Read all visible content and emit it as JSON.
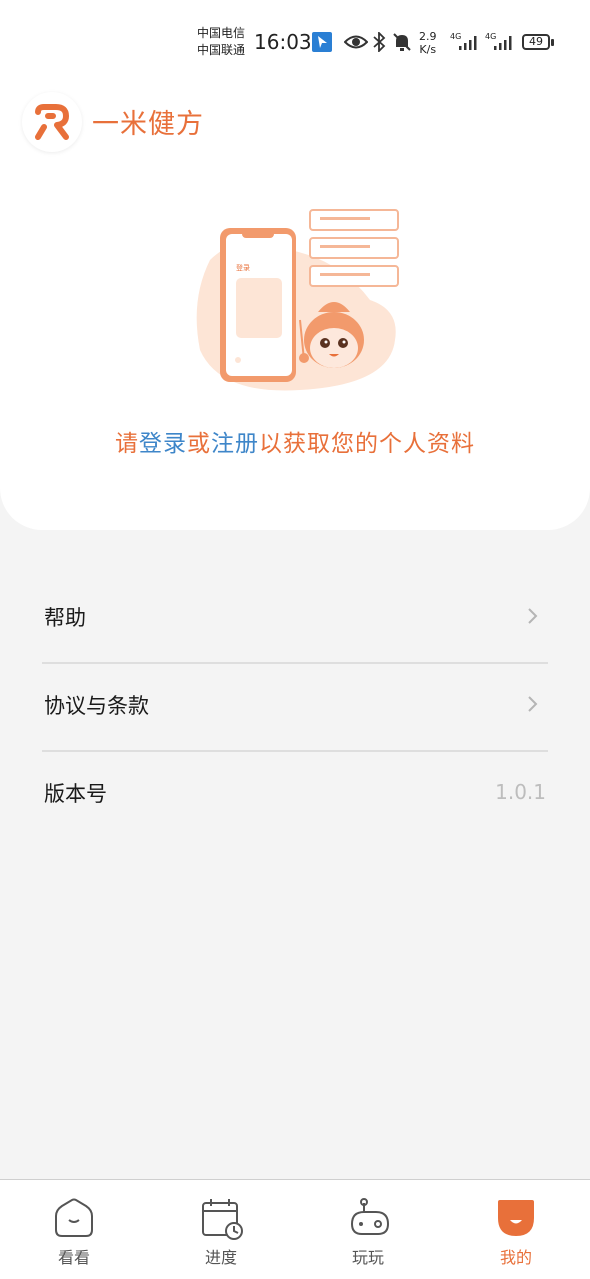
{
  "status_bar": {
    "carrier_1": "中国电信",
    "carrier_2": "中国联通",
    "time": "16:03",
    "speed_value": "2.9",
    "speed_unit": "K/s",
    "network_1": "4G",
    "network_2": "4G",
    "battery": "49",
    "icons": [
      "location-arrow-icon",
      "eye-icon",
      "bluetooth-icon",
      "mute-bell-icon",
      "signal-icon"
    ]
  },
  "header": {
    "app_name": "一米健方",
    "logo_icon": "r-logo-icon"
  },
  "login_prompt": {
    "part1": "请",
    "login_link": "登录",
    "part2": "或",
    "register_link": "注册",
    "part3": "以获取您的个人资料",
    "illustration_text": "登录"
  },
  "menu": {
    "help_label": "帮助",
    "terms_label": "协议与条款",
    "version_label": "版本号",
    "version_value": "1.0.1"
  },
  "tabs": [
    {
      "label": "看看",
      "icon": "home-icon",
      "active": false
    },
    {
      "label": "进度",
      "icon": "calendar-clock-icon",
      "active": false
    },
    {
      "label": "玩玩",
      "icon": "game-icon",
      "active": false
    },
    {
      "label": "我的",
      "icon": "profile-face-icon",
      "active": true
    }
  ],
  "colors": {
    "accent": "#e8703a",
    "link": "#3e86c9",
    "background": "#f4f4f4"
  }
}
